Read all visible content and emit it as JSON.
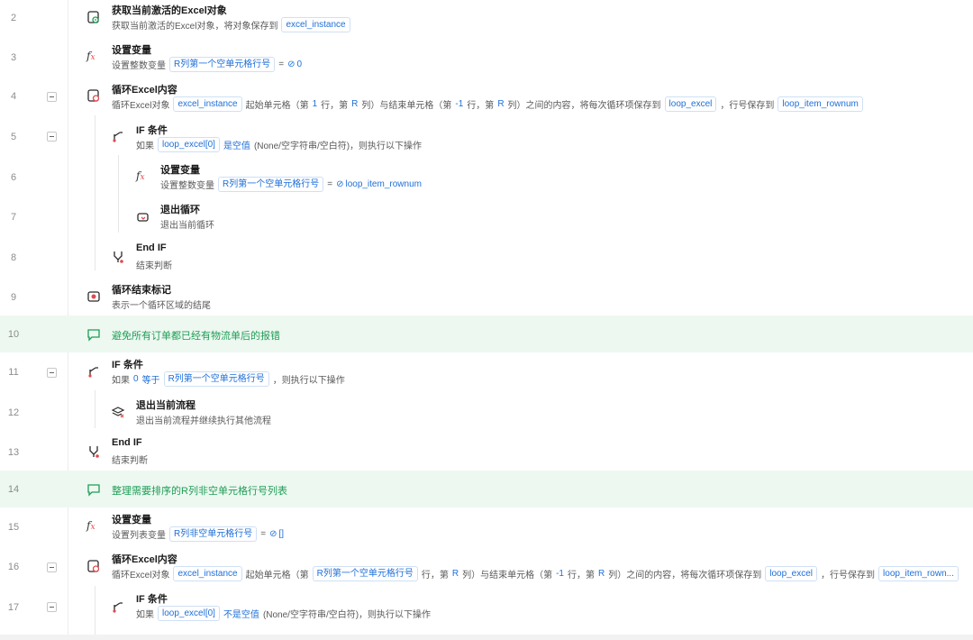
{
  "rows": [
    {
      "num": "2",
      "title": "获取当前激活的Excel对象",
      "desc_pre": "获取当前激活的Excel对象，将对象保存到",
      "var1": "excel_instance"
    },
    {
      "num": "3",
      "title": "设置变量",
      "desc_pre": "设置整数变量",
      "var1": "R列第一个空单元格行号",
      "eq": "=",
      "value": "0"
    },
    {
      "num": "4",
      "title": "循环Excel内容",
      "desc_pre": "循环Excel对象",
      "var1": "excel_instance",
      "desc_mid1": "起始单元格（第",
      "n1": "1",
      "desc_mid2": "行，第",
      "n2": "R",
      "desc_mid3": "列）与结束单元格（第",
      "n3": "-1",
      "desc_mid4": "行，第",
      "n4": "R",
      "desc_mid5": "列）之间的内容，将每次循环项保存到",
      "var2": "loop_excel",
      "desc_mid6": "，行号保存到",
      "var3": "loop_item_rownum"
    },
    {
      "num": "5",
      "title": "IF 条件",
      "desc_pre": "如果",
      "var1": "loop_excel[0]",
      "op": "是空值",
      "desc_post": "(None/空字符串/空白符)，则执行以下操作"
    },
    {
      "num": "6",
      "title": "设置变量",
      "desc_pre": "设置整数变量",
      "var1": "R列第一个空单元格行号",
      "eq": "=",
      "value": "loop_item_rownum"
    },
    {
      "num": "7",
      "title": "退出循环",
      "desc_pre": "退出当前循环"
    },
    {
      "num": "8",
      "title": "End IF",
      "desc_pre": "结束判断"
    },
    {
      "num": "9",
      "title": "循环结束标记",
      "desc_pre": "表示一个循环区域的结尾"
    },
    {
      "num": "10",
      "comment": "避免所有订单都已经有物流单后的报错"
    },
    {
      "num": "11",
      "title": "IF 条件",
      "desc_pre": "如果",
      "n1": "0",
      "op": "等于",
      "var1": "R列第一个空单元格行号",
      "desc_post": "，则执行以下操作"
    },
    {
      "num": "12",
      "title": "退出当前流程",
      "desc_pre": "退出当前流程并继续执行其他流程"
    },
    {
      "num": "13",
      "title": "End IF",
      "desc_pre": "结束判断"
    },
    {
      "num": "14",
      "comment": "整理需要排序的R列非空单元格行号列表"
    },
    {
      "num": "15",
      "title": "设置变量",
      "desc_pre": "设置列表变量",
      "var1": "R列非空单元格行号",
      "eq": "=",
      "value": "[]"
    },
    {
      "num": "16",
      "title": "循环Excel内容",
      "desc_pre": "循环Excel对象",
      "var1": "excel_instance",
      "desc_mid1": "起始单元格（第",
      "var2": "R列第一个空单元格行号",
      "desc_mid2": "行，第",
      "n2": "R",
      "desc_mid3": "列）与结束单元格（第",
      "n3": "-1",
      "desc_mid4": "行，第",
      "n4": "R",
      "desc_mid5": "列）之间的内容，将每次循环项保存到",
      "var3": "loop_excel",
      "desc_mid6": "，行号保存到",
      "var4": "loop_item_rown..."
    },
    {
      "num": "17",
      "title": "IF 条件",
      "desc_pre": "如果",
      "var1": "loop_excel[0]",
      "op": "不是空值",
      "desc_post": "(None/空字符串/空白符)，则执行以下操作"
    }
  ],
  "icons": {
    "excel-get": "excel-get-icon",
    "fx": "fx-icon",
    "excel-loop": "excel-loop-icon",
    "if": "if-branch-icon",
    "break": "break-loop-icon",
    "endif": "end-if-icon",
    "loop-end": "loop-end-icon",
    "comment": "comment-icon",
    "exit": "exit-flow-icon"
  },
  "colors": {
    "accent": "#1e6fd9",
    "comment_text": "#1f9d55",
    "comment_bg": "#edf8f1",
    "red": "#e5484d"
  }
}
